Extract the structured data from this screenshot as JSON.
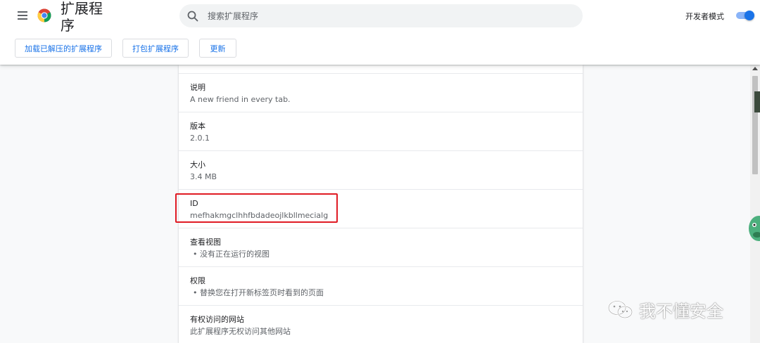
{
  "header": {
    "title": "扩展程序",
    "search_placeholder": "搜索扩展程序",
    "dev_mode_label": "开发者模式",
    "dev_mode_enabled": true
  },
  "toolbar": {
    "load_unpacked": "加载已解压的扩展程序",
    "pack": "打包扩展程序",
    "update": "更新"
  },
  "details": {
    "description": {
      "label": "说明",
      "value": "A new friend in every tab."
    },
    "version": {
      "label": "版本",
      "value": "2.0.1"
    },
    "size": {
      "label": "大小",
      "value": "3.4 MB"
    },
    "id": {
      "label": "ID",
      "value": "mefhakmgclhhfbdadeojlkbllmecialg"
    },
    "views": {
      "label": "查看视图",
      "value": "没有正在运行的视图"
    },
    "permissions": {
      "label": "权限",
      "value": "替换您在打开新标签页时看到的页面"
    },
    "site_access": {
      "label": "有权访问的网站",
      "value": "此扩展程序无权访问其他网站"
    }
  },
  "watermark": {
    "text": "我不懂安全"
  },
  "colors": {
    "accent": "#1a73e8",
    "highlight": "#e01b24"
  }
}
